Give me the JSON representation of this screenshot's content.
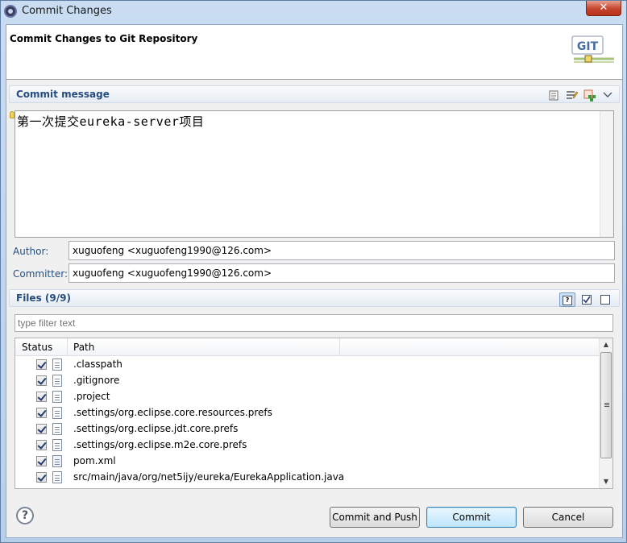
{
  "window": {
    "title": "Commit Changes",
    "close_label": "✕"
  },
  "header": {
    "title": "Commit Changes to Git Repository",
    "logo_text": "GIT"
  },
  "commit_section": {
    "label": "Commit message",
    "message": "第一次提交eureka-server项目",
    "toolbar_icons": [
      "spellcheck-icon",
      "previous-messages-icon",
      "signed-off-icon",
      "menu-chevron-icon"
    ]
  },
  "author": {
    "label": "Author:",
    "value": "xuguofeng <xuguofeng1990@126.com>"
  },
  "committer": {
    "label": "Committer:",
    "value": "xuguofeng <xuguofeng1990@126.com>"
  },
  "files_section": {
    "label": "Files (9/9)",
    "filter_placeholder": "type filter text",
    "columns": [
      "Status",
      "Path"
    ],
    "files": [
      {
        "path": ".classpath",
        "checked": true,
        "icon": "xml-file-icon"
      },
      {
        "path": ".gitignore",
        "checked": true,
        "icon": "text-file-icon"
      },
      {
        "path": ".project",
        "checked": true,
        "icon": "xml-file-icon"
      },
      {
        "path": ".settings/org.eclipse.core.resources.prefs",
        "checked": true,
        "icon": "text-file-icon"
      },
      {
        "path": ".settings/org.eclipse.jdt.core.prefs",
        "checked": true,
        "icon": "text-file-icon"
      },
      {
        "path": ".settings/org.eclipse.m2e.core.prefs",
        "checked": true,
        "icon": "text-file-icon"
      },
      {
        "path": "pom.xml",
        "checked": true,
        "icon": "maven-file-icon"
      },
      {
        "path": "src/main/java/org/net5ijy/eureka/EurekaApplication.java",
        "checked": true,
        "icon": "java-file-icon"
      }
    ]
  },
  "buttons": {
    "commit_and_push": "Commit and Push",
    "commit": "Commit",
    "cancel": "Cancel",
    "help": "?"
  },
  "colors": {
    "section_label": "#274c7e",
    "field_label": "#224e84",
    "close_button": "#c7442c"
  }
}
